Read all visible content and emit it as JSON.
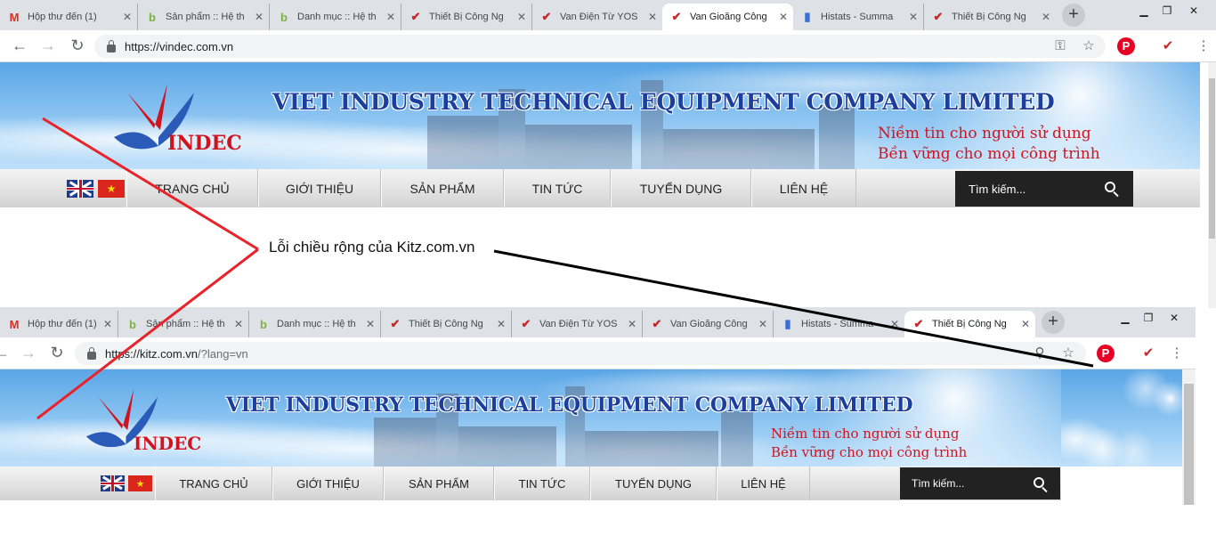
{
  "top_browser": {
    "tabs": [
      {
        "label": "Hộp thư đến (1)",
        "icon": "gmail-icon",
        "glyph": "M",
        "color": "#d93025"
      },
      {
        "label": "Sản phẩm :: Hệ th",
        "icon": "b-favicon-icon",
        "glyph": "b",
        "color": "#7cb342"
      },
      {
        "label": "Danh mục :: Hệ th",
        "icon": "b-favicon-icon",
        "glyph": "b",
        "color": "#7cb342"
      },
      {
        "label": "Thiết Bị Công Ng",
        "icon": "vindec-favicon-icon",
        "glyph": "✔",
        "color": "#c62828"
      },
      {
        "label": "Van Điện Từ YOS",
        "icon": "vindec-favicon-icon",
        "glyph": "✔",
        "color": "#c62828"
      },
      {
        "label": "Van Gioăng Công",
        "icon": "vindec-favicon-icon",
        "glyph": "✔",
        "color": "#c62828"
      },
      {
        "label": "Histats - Summa",
        "icon": "histats-icon",
        "glyph": "▮",
        "color": "#3b6fd6"
      },
      {
        "label": "Thiết Bị Công Ng",
        "icon": "vindec-favicon-icon",
        "glyph": "✔",
        "color": "#c62828"
      }
    ],
    "url_host": "https://vindec.com.vn",
    "url_path": ""
  },
  "bottom_browser": {
    "tabs": [
      {
        "label": "Hộp thư đến (1)",
        "icon": "gmail-icon",
        "glyph": "M",
        "color": "#d93025"
      },
      {
        "label": "Sản phẩm :: Hệ th",
        "icon": "b-favicon-icon",
        "glyph": "b",
        "color": "#7cb342"
      },
      {
        "label": "Danh mục :: Hệ th",
        "icon": "b-favicon-icon",
        "glyph": "b",
        "color": "#7cb342"
      },
      {
        "label": "Thiết Bị Công Ng",
        "icon": "vindec-favicon-icon",
        "glyph": "✔",
        "color": "#c62828"
      },
      {
        "label": "Van Điện Từ YOS",
        "icon": "vindec-favicon-icon",
        "glyph": "✔",
        "color": "#c62828"
      },
      {
        "label": "Van Gioăng Công",
        "icon": "vindec-favicon-icon",
        "glyph": "✔",
        "color": "#c62828"
      },
      {
        "label": "Histats - Summa",
        "icon": "histats-icon",
        "glyph": "▮",
        "color": "#3b6fd6"
      },
      {
        "label": "Thiết Bị Công Ng",
        "icon": "vindec-favicon-icon",
        "glyph": "✔",
        "color": "#c62828"
      }
    ],
    "url_host": "https://kitz.com.vn",
    "url_path": "/?lang=vn"
  },
  "site": {
    "company_name": "VIET INDUSTRY TECHNICAL EQUIPMENT COMPANY LIMITED",
    "slogan_1": "Niềm tin cho người sử dụng",
    "slogan_2": "Bền vững cho mọi công trình",
    "logo_text": "INDEC",
    "nav": [
      "TRANG CHỦ",
      "GIỚI THIỆU",
      "SẢN PHẨM",
      "TIN TỨC",
      "TUYỂN DỤNG",
      "LIÊN HỆ"
    ],
    "search_placeholder": "Tìm kiếm..."
  },
  "annotation": {
    "text": "Lỗi chiều rộng của Kitz.com.vn",
    "red_color": "#e8232a",
    "black_color": "#000000"
  },
  "colors": {
    "company_blue": "#1c3f9e",
    "slogan_red": "#d0141f",
    "search_bg": "#222222",
    "tabstrip": "#dee1e6"
  }
}
